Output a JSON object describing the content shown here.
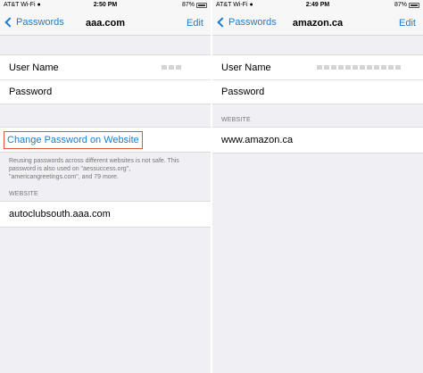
{
  "left": {
    "status": {
      "carrier": "AT&T Wi-Fi",
      "time": "2:50 PM",
      "battery": "87%"
    },
    "nav": {
      "back": "Passwords",
      "title": "aaa.com",
      "edit": "Edit"
    },
    "fields": {
      "username_label": "User Name",
      "password_label": "Password"
    },
    "change_password": "Change Password on Website",
    "warning": "Reusing passwords across different websites is not safe. This password is also used on \"aessuccess.org\", \"americangreetings.com\", and 79 more.",
    "website_header": "WEBSITE",
    "website": "autoclubsouth.aaa.com"
  },
  "right": {
    "status": {
      "carrier": "AT&T Wi-Fi",
      "time": "2:49 PM",
      "battery": "87%"
    },
    "nav": {
      "back": "Passwords",
      "title": "amazon.ca",
      "edit": "Edit"
    },
    "fields": {
      "username_label": "User Name",
      "password_label": "Password"
    },
    "website_header": "WEBSITE",
    "website": "www.amazon.ca"
  },
  "colors": {
    "link": "#1a7ccf",
    "highlight_border": "#e2533f",
    "background": "#efeff4"
  },
  "icons": [
    "wifi-icon",
    "battery-icon",
    "back-chevron-icon"
  ]
}
